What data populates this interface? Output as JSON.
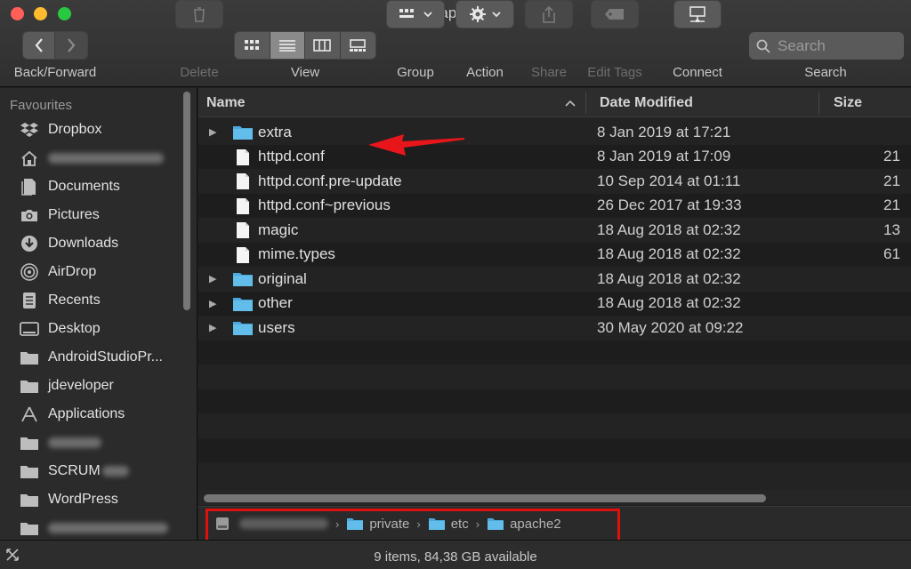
{
  "window": {
    "title": "apache2"
  },
  "toolbar": {
    "nav_label": "Back/Forward",
    "delete_label": "Delete",
    "view_label": "View",
    "group_label": "Group",
    "action_label": "Action",
    "share_label": "Share",
    "edit_tags_label": "Edit Tags",
    "connect_label": "Connect",
    "search_label": "Search",
    "search_placeholder": "Search"
  },
  "sidebar": {
    "header": "Favourites",
    "items": [
      {
        "label": "Dropbox",
        "icon": "dropbox-icon"
      },
      {
        "label": "",
        "icon": "home-icon"
      },
      {
        "label": "Documents",
        "icon": "documents-icon"
      },
      {
        "label": "Pictures",
        "icon": "camera-icon"
      },
      {
        "label": "Downloads",
        "icon": "download-icon"
      },
      {
        "label": "AirDrop",
        "icon": "airdrop-icon"
      },
      {
        "label": "Recents",
        "icon": "recents-icon"
      },
      {
        "label": "Desktop",
        "icon": "desktop-icon"
      },
      {
        "label": "AndroidStudioPr...",
        "icon": "folder-icon"
      },
      {
        "label": "jdeveloper",
        "icon": "folder-icon"
      },
      {
        "label": "Applications",
        "icon": "applications-icon"
      },
      {
        "label": "",
        "icon": "folder-icon"
      },
      {
        "label": "SCRUM",
        "icon": "folder-icon"
      },
      {
        "label": "WordPress",
        "icon": "folder-icon"
      },
      {
        "label": "",
        "icon": "folder-icon"
      }
    ]
  },
  "columns": {
    "name": "Name",
    "date": "Date Modified",
    "size": "Size"
  },
  "files": [
    {
      "name": "extra",
      "date": "8 Jan 2019 at 17:21",
      "size": "",
      "kind": "folder"
    },
    {
      "name": "httpd.conf",
      "date": "8 Jan 2019 at 17:09",
      "size": "21",
      "kind": "file"
    },
    {
      "name": "httpd.conf.pre-update",
      "date": "10 Sep 2014 at 01:11",
      "size": "21",
      "kind": "file"
    },
    {
      "name": "httpd.conf~previous",
      "date": "26 Dec 2017 at 19:33",
      "size": "21",
      "kind": "file"
    },
    {
      "name": "magic",
      "date": "18 Aug 2018 at 02:32",
      "size": "13",
      "kind": "file"
    },
    {
      "name": "mime.types",
      "date": "18 Aug 2018 at 02:32",
      "size": "61",
      "kind": "file"
    },
    {
      "name": "original",
      "date": "18 Aug 2018 at 02:32",
      "size": "",
      "kind": "folder"
    },
    {
      "name": "other",
      "date": "18 Aug 2018 at 02:32",
      "size": "",
      "kind": "folder"
    },
    {
      "name": "users",
      "date": "30 May 2020 at 09:22",
      "size": "",
      "kind": "folder"
    }
  ],
  "pathbar": {
    "crumbs": [
      "private",
      "etc",
      "apache2"
    ]
  },
  "status": {
    "text": "9 items, 84,38 GB available"
  },
  "colors": {
    "folder": "#5bb6e6",
    "highlight_red": "#e01010",
    "arrow_red": "#e8161b"
  }
}
